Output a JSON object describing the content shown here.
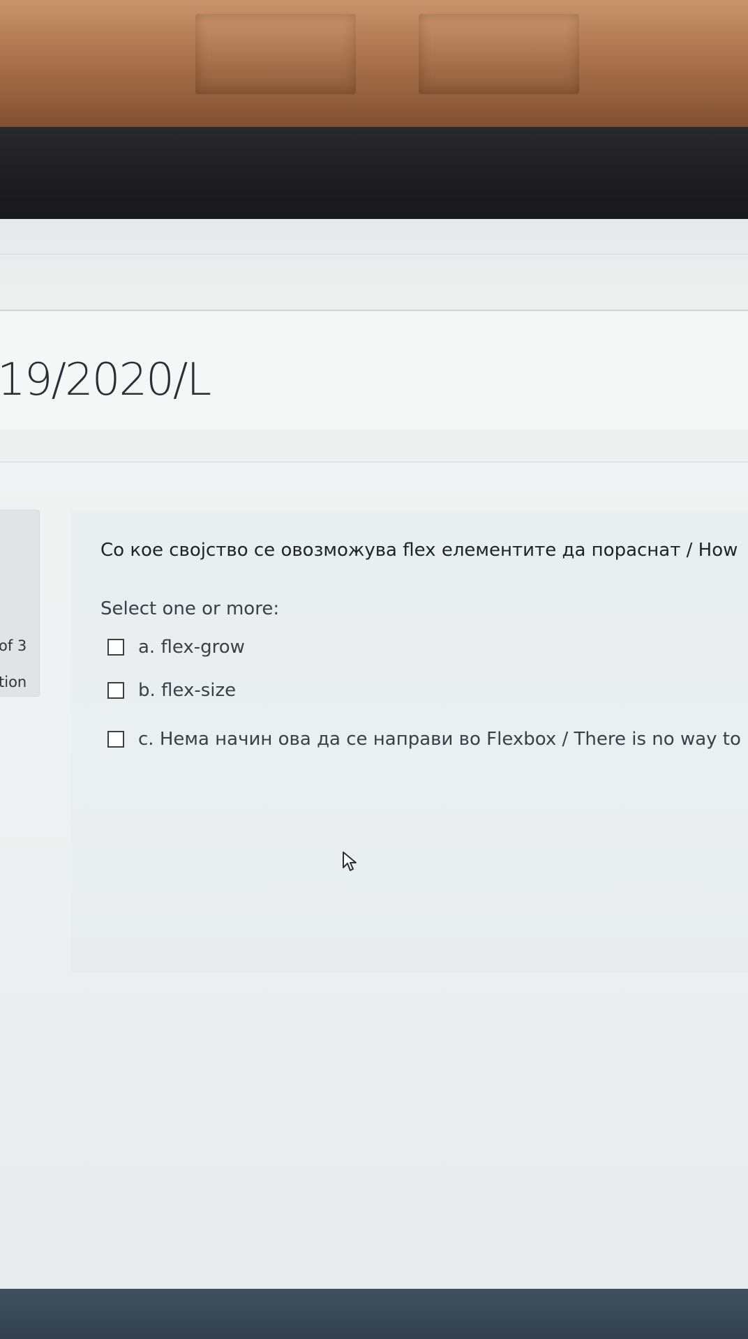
{
  "course": {
    "title": "19/2020/L"
  },
  "info_panel": {
    "question_counter_fragment": "of 3",
    "flag_fragment": "tion"
  },
  "question": {
    "text": "Со кое својство се овозможува flex елементите да пораснат / How",
    "prompt": "Select one or more:",
    "answers": [
      {
        "label": "a. flex-grow",
        "checked": false
      },
      {
        "label": "b. flex-size",
        "checked": false
      },
      {
        "label": "c. Нема начин ова да се направи во Flexbox / There is no way to",
        "checked": false
      }
    ]
  },
  "colors": {
    "background": "#eef1f1",
    "card": "#e9eef1",
    "text": "#1f2326",
    "muted_text": "#3a4045",
    "taskbar": "#3a4857"
  },
  "icons": {
    "checkbox": "empty-checkbox-icon",
    "pointer": "mouse-pointer-icon"
  }
}
